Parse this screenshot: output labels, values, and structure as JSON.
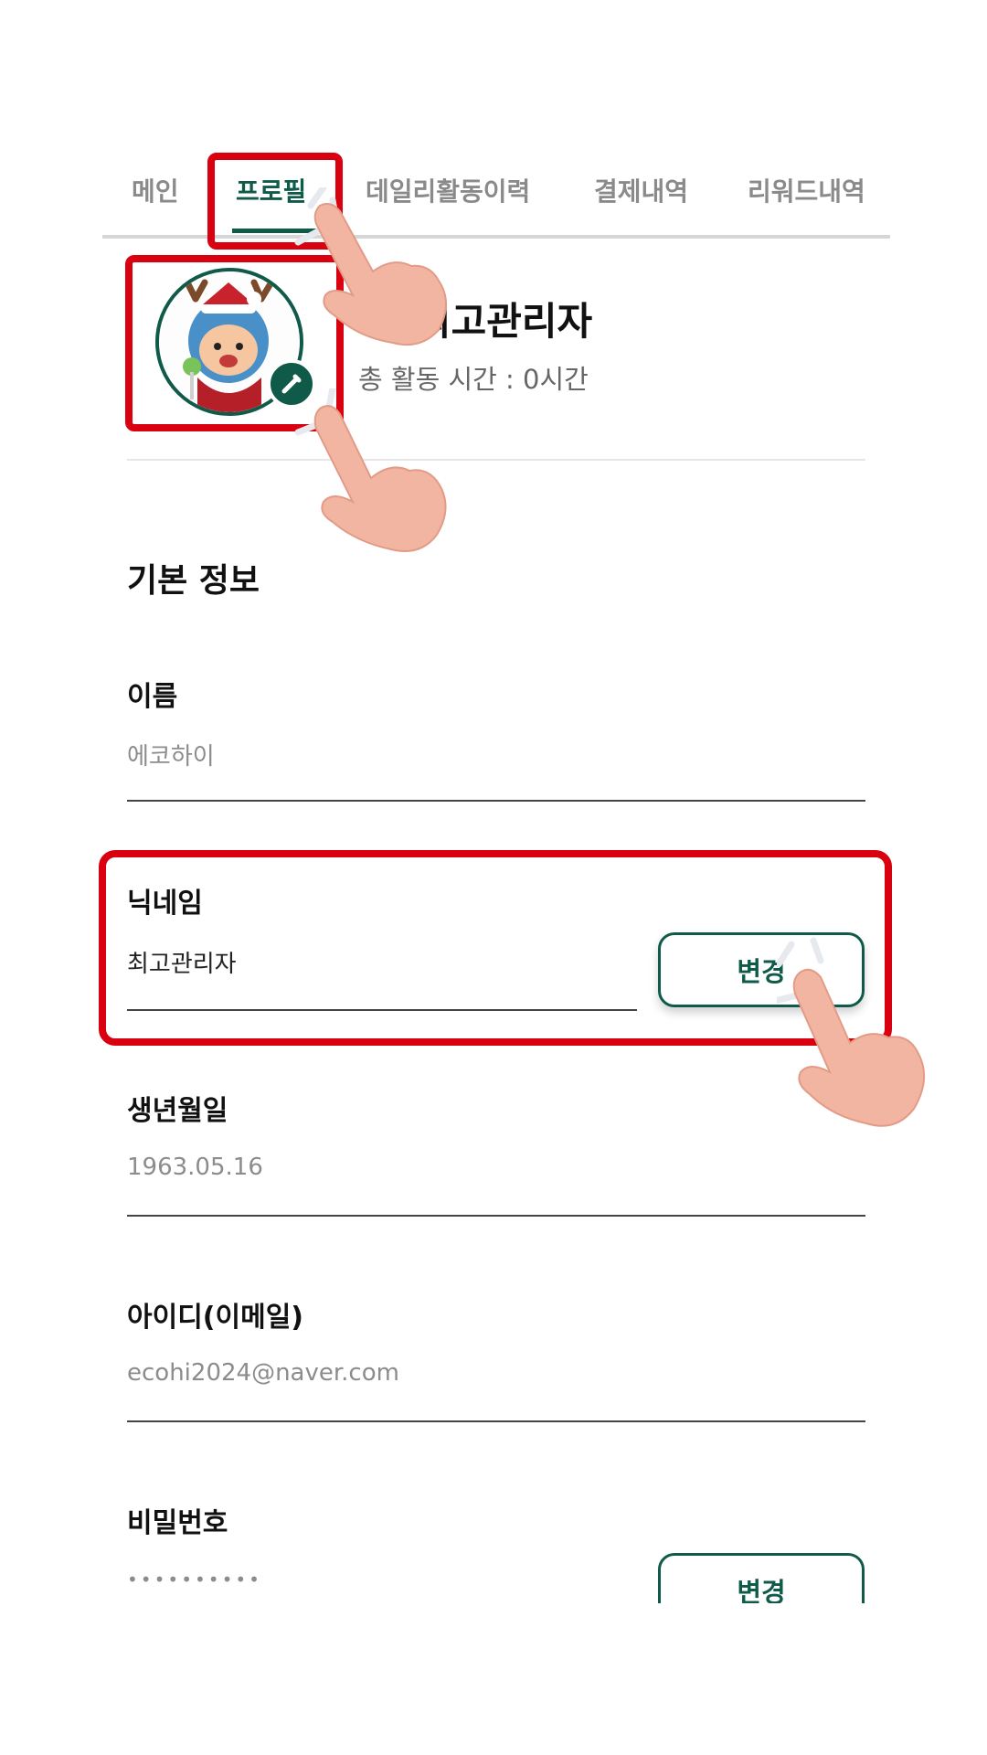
{
  "tabs": [
    {
      "label": "메인",
      "active": false
    },
    {
      "label": "프로필",
      "active": true
    },
    {
      "label": "데일리활동이력",
      "active": false
    },
    {
      "label": "결제내역",
      "active": false
    },
    {
      "label": "리워드내역",
      "active": false
    }
  ],
  "profile": {
    "name": "최고관리자",
    "activity_time": "총 활동 시간 : 0시간"
  },
  "basic_info": {
    "title": "기본 정보",
    "name": {
      "label": "이름",
      "value": "에코하이"
    },
    "nickname": {
      "label": "닉네임",
      "value": "최고관리자",
      "button": "변경"
    },
    "birthdate": {
      "label": "생년월일",
      "value": "1963.05.16"
    },
    "account_id": {
      "label": "아이디(이메일)",
      "value": "ecohi2024@naver.com"
    },
    "password": {
      "label": "비밀번호",
      "value": "••••••••••",
      "button": "변경"
    }
  },
  "icons": {
    "avatar": "reindeer-mascot-avatar",
    "edit_badge": "pencil-edit-icon",
    "pointer": "pointing-hand-icon"
  },
  "colors": {
    "accent": "#0f5a48",
    "highlight": "#d9000f",
    "inactive_tab": "#8a8a8a"
  }
}
